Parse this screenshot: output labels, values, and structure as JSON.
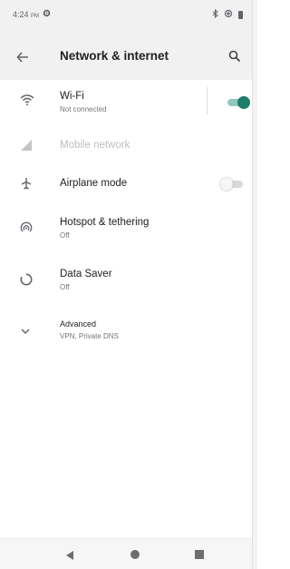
{
  "status_bar": {
    "time": "4:24",
    "ampm": "PM",
    "icons": [
      "gear-icon",
      "bluetooth-icon",
      "data-saver-icon",
      "battery-icon"
    ]
  },
  "app_bar": {
    "title": "Network & internet",
    "back_icon": "arrow-back-icon",
    "search_icon": "search-icon"
  },
  "items": [
    {
      "id": "wifi",
      "icon": "wifi-icon",
      "title": "Wi-Fi",
      "subtitle": "Not connected",
      "toggle": true
    },
    {
      "id": "mobile-network",
      "icon": "signal-icon",
      "title": "Mobile network",
      "disabled": true
    },
    {
      "id": "airplane-mode",
      "icon": "airplane-icon",
      "title": "Airplane mode",
      "toggle": false
    },
    {
      "id": "hotspot",
      "icon": "hotspot-icon",
      "title": "Hotspot & tethering",
      "subtitle": "Off"
    },
    {
      "id": "data-saver",
      "icon": "data-saver-icon",
      "title": "Data Saver",
      "subtitle": "Off"
    },
    {
      "id": "advanced",
      "icon": "chevron-down-icon",
      "title": "Advanced",
      "subtitle": "VPN, Private DNS"
    }
  ],
  "nav_bar": {
    "icons": [
      "nav-back-icon",
      "nav-home-icon",
      "nav-recents-icon"
    ]
  },
  "colors": {
    "accent": "#1e7d6b",
    "accent_track": "#8fc8be",
    "app_bar_bg": "#f1f1f1"
  }
}
